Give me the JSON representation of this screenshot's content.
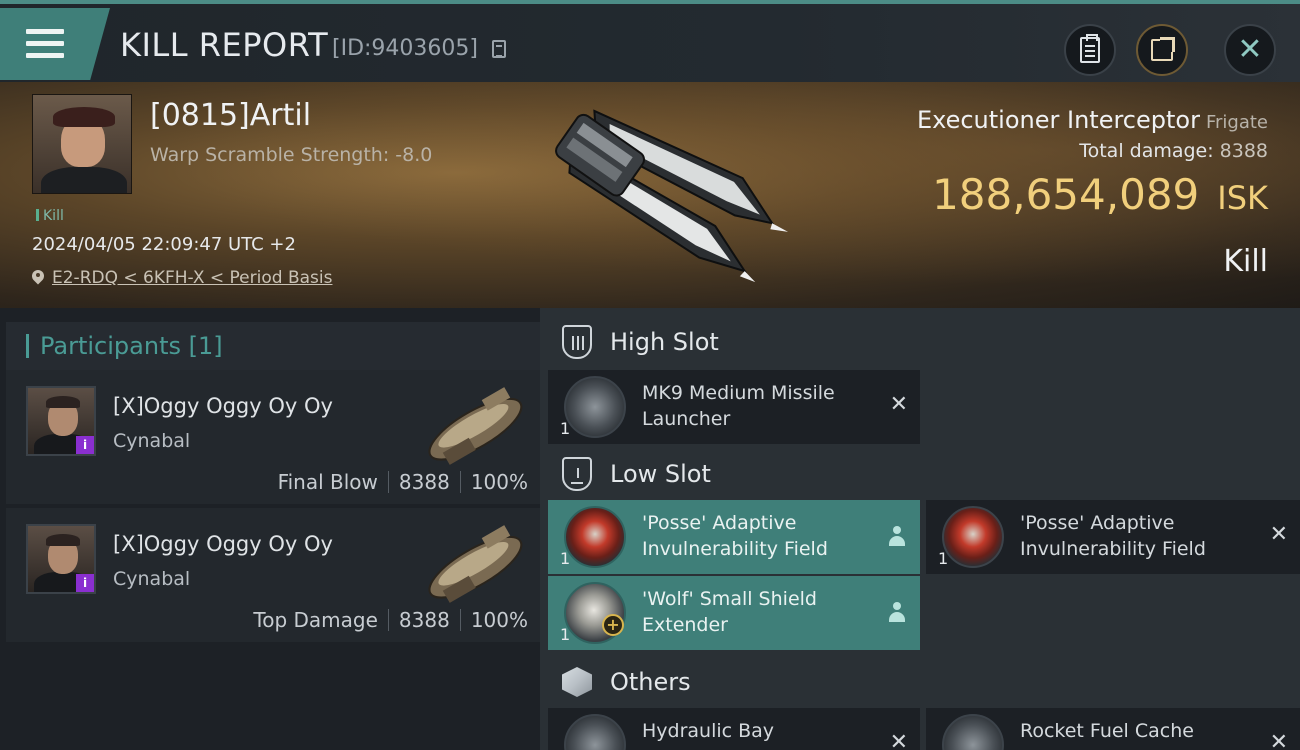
{
  "header": {
    "title": "KILL REPORT",
    "id_text": "[ID:9403605]"
  },
  "victim": {
    "pilot_name": "[0815]Artil",
    "warp_scramble": "Warp Scramble Strength: -8.0",
    "tag": "Kill",
    "datetime": "2024/04/05 22:09:47 UTC +2",
    "location": "E2-RDQ < 6KFH-X < Period Basis",
    "ship_name": "Executioner Interceptor",
    "ship_class": "Frigate",
    "total_damage_label": "Total damage:",
    "total_damage": "8388",
    "isk_value": "188,654,089",
    "isk_unit": "ISK",
    "result": "Kill"
  },
  "participants": {
    "header": "Participants [1]",
    "rows": [
      {
        "name": "[X]Oggy Oggy Oy Oy",
        "ship": "Cynabal",
        "role": "Final Blow",
        "damage": "8388",
        "percent": "100%",
        "badge": "i"
      },
      {
        "name": "[X]Oggy Oggy Oy Oy",
        "ship": "Cynabal",
        "role": "Top Damage",
        "damage": "8388",
        "percent": "100%",
        "badge": "i"
      }
    ]
  },
  "fitting": {
    "high_slot": {
      "label": "High Slot",
      "items": [
        {
          "name": "MK9 Medium Missile Launcher",
          "qty": "1"
        }
      ]
    },
    "low_slot": {
      "label": "Low Slot",
      "items": [
        {
          "name": "'Posse' Adaptive Invulnerability Field",
          "qty": "1"
        },
        {
          "name": "'Posse' Adaptive Invulnerability Field",
          "qty": "1"
        },
        {
          "name": "'Wolf' Small Shield Extender",
          "qty": "1"
        }
      ]
    },
    "others": {
      "label": "Others",
      "items": [
        {
          "name": "Hydraulic Bay"
        },
        {
          "name": "Rocket Fuel Cache"
        }
      ]
    }
  },
  "colors": {
    "accent": "#3f7f79",
    "isk": "#f1cf7c",
    "participants_header": "#4a9b95",
    "badge": "#8a2fd0"
  }
}
